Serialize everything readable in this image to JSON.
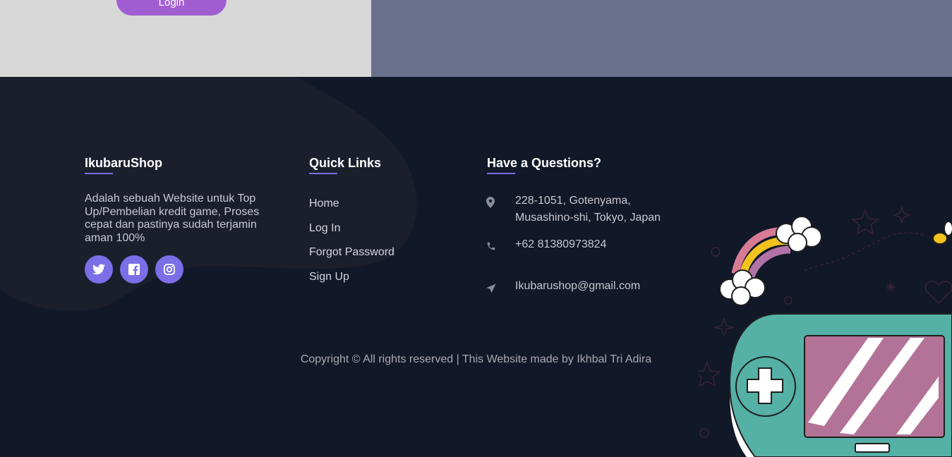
{
  "header": {
    "login_label": "Login"
  },
  "footer": {
    "about": {
      "title": "IkubaruShop",
      "description": "Adalah sebuah Website untuk Top Up/Pembelian kredit game, Proses cepat dan pastinya sudah terjamin aman 100%",
      "socials": [
        {
          "name": "twitter",
          "icon": "twitter-icon"
        },
        {
          "name": "facebook",
          "icon": "facebook-icon"
        },
        {
          "name": "instagram",
          "icon": "instagram-icon"
        }
      ]
    },
    "quick_links": {
      "title": "Quick Links",
      "items": [
        "Home",
        "Log In",
        "Forgot Password",
        "Sign Up"
      ]
    },
    "contact": {
      "title": "Have a Questions?",
      "address_line1": "228-1051, Gotenyama,",
      "address_line2": "Musashino-shi, Tokyo, Japan",
      "phone": "+62 81380973824",
      "email": "Ikubarushop@gmail.com"
    },
    "copyright": "Copyright © All rights reserved | This Website made by Ikhbal Tri Adira"
  },
  "colors": {
    "accent": "#7b6cf0",
    "login_button": "#a15ed2",
    "footer_bg": "#111827",
    "top_left_bg": "#d8d8d8",
    "top_right_bg": "#6a718d"
  }
}
